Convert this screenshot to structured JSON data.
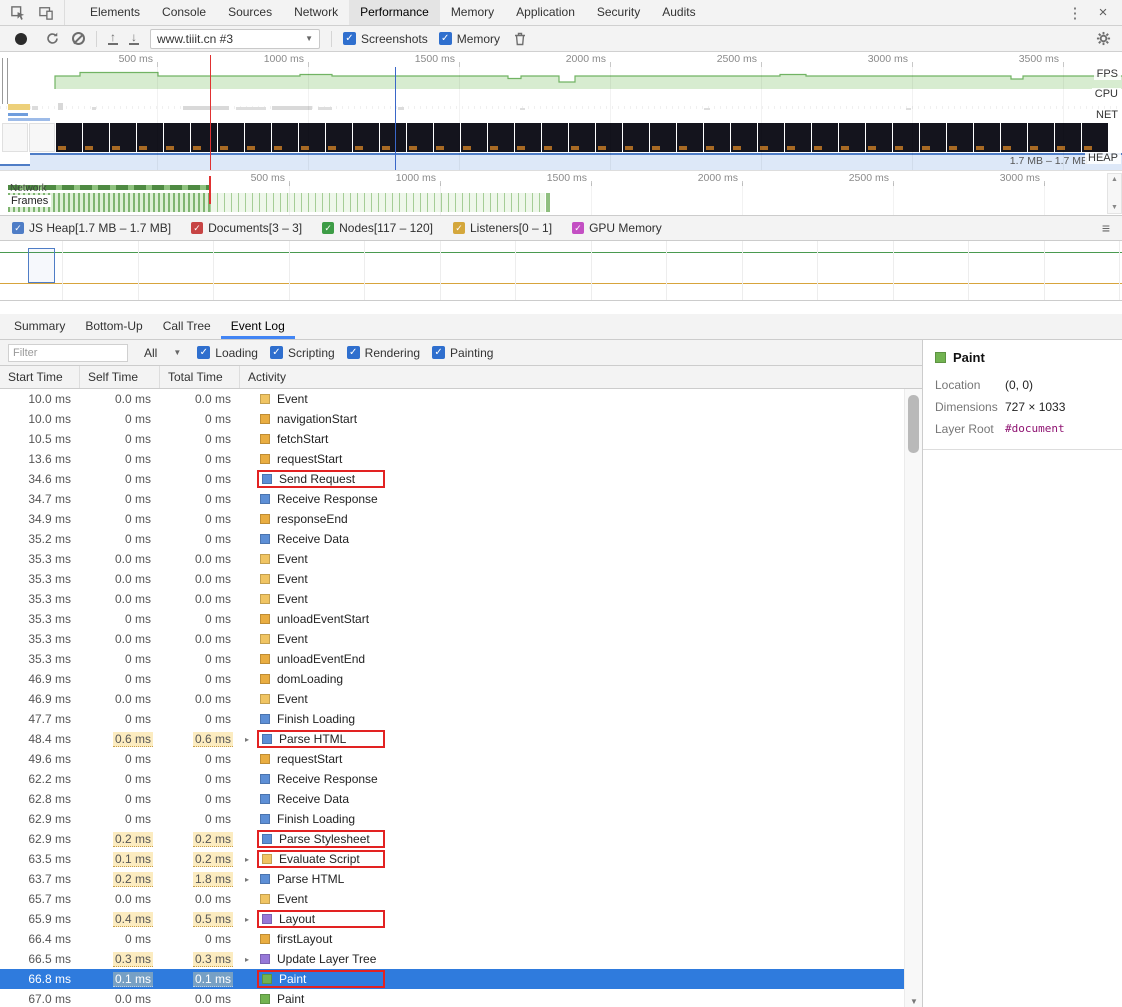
{
  "devtools": {
    "tabs": [
      "Elements",
      "Console",
      "Sources",
      "Network",
      "Performance",
      "Memory",
      "Application",
      "Security",
      "Audits"
    ],
    "active_tab": "Performance"
  },
  "toolbar": {
    "url_select": "www.tiiit.cn #3",
    "screenshots_label": "Screenshots",
    "memory_label": "Memory"
  },
  "overview": {
    "ruler_labels": [
      "500 ms",
      "1000 ms",
      "1500 ms",
      "2000 ms",
      "2500 ms",
      "3000 ms",
      "3500 ms"
    ],
    "track_labels": {
      "fps": "FPS",
      "cpu": "CPU",
      "net": "NET",
      "heap": "HEAP"
    },
    "heap_range": "1.7 MB – 1.7 MB",
    "filmstrip_count": 41,
    "filmstrip_light_count": 2
  },
  "timeline": {
    "network_label": "Network",
    "frames_label": "Frames"
  },
  "counters": {
    "items": [
      {
        "label": "JS Heap[1.7 MB – 1.7 MB]",
        "color": "#4f7dc6",
        "checked": true
      },
      {
        "label": "Documents[3 – 3]",
        "color": "#c74444",
        "checked": true
      },
      {
        "label": "Nodes[117 – 120]",
        "color": "#3d9c46",
        "checked": true
      },
      {
        "label": "Listeners[0 – 1]",
        "color": "#d4a73c",
        "checked": true
      },
      {
        "label": "GPU Memory",
        "color": "#c34fc3",
        "checked": true
      }
    ]
  },
  "detail_tabs": {
    "items": [
      "Summary",
      "Bottom-Up",
      "Call Tree",
      "Event Log"
    ],
    "active": "Event Log"
  },
  "filter_bar": {
    "filter_placeholder": "Filter",
    "duration": "All",
    "checkboxes": [
      "Loading",
      "Scripting",
      "Rendering",
      "Painting"
    ]
  },
  "event_log": {
    "columns": [
      "Start Time",
      "Self Time",
      "Total Time",
      "Activity"
    ],
    "rows": [
      {
        "start": "10.0 ms",
        "self": "0.0 ms",
        "total": "0.0 ms",
        "activity": "Event",
        "cat": "scripting"
      },
      {
        "start": "10.0 ms",
        "self": "0 ms",
        "total": "0 ms",
        "activity": "navigationStart",
        "cat": "timestamp"
      },
      {
        "start": "10.5 ms",
        "self": "0 ms",
        "total": "0 ms",
        "activity": "fetchStart",
        "cat": "timestamp"
      },
      {
        "start": "13.6 ms",
        "self": "0 ms",
        "total": "0 ms",
        "activity": "requestStart",
        "cat": "timestamp"
      },
      {
        "start": "34.6 ms",
        "self": "0 ms",
        "total": "0 ms",
        "activity": "Send Request",
        "cat": "loading",
        "redbox": true
      },
      {
        "start": "34.7 ms",
        "self": "0 ms",
        "total": "0 ms",
        "activity": "Receive Response",
        "cat": "loading"
      },
      {
        "start": "34.9 ms",
        "self": "0 ms",
        "total": "0 ms",
        "activity": "responseEnd",
        "cat": "timestamp"
      },
      {
        "start": "35.2 ms",
        "self": "0 ms",
        "total": "0 ms",
        "activity": "Receive Data",
        "cat": "loading"
      },
      {
        "start": "35.3 ms",
        "self": "0.0 ms",
        "total": "0.0 ms",
        "activity": "Event",
        "cat": "scripting"
      },
      {
        "start": "35.3 ms",
        "self": "0.0 ms",
        "total": "0.0 ms",
        "activity": "Event",
        "cat": "scripting"
      },
      {
        "start": "35.3 ms",
        "self": "0.0 ms",
        "total": "0.0 ms",
        "activity": "Event",
        "cat": "scripting"
      },
      {
        "start": "35.3 ms",
        "self": "0 ms",
        "total": "0 ms",
        "activity": "unloadEventStart",
        "cat": "timestamp"
      },
      {
        "start": "35.3 ms",
        "self": "0.0 ms",
        "total": "0.0 ms",
        "activity": "Event",
        "cat": "scripting"
      },
      {
        "start": "35.3 ms",
        "self": "0 ms",
        "total": "0 ms",
        "activity": "unloadEventEnd",
        "cat": "timestamp"
      },
      {
        "start": "46.9 ms",
        "self": "0 ms",
        "total": "0 ms",
        "activity": "domLoading",
        "cat": "timestamp"
      },
      {
        "start": "46.9 ms",
        "self": "0.0 ms",
        "total": "0.0 ms",
        "activity": "Event",
        "cat": "scripting"
      },
      {
        "start": "47.7 ms",
        "self": "0 ms",
        "total": "0 ms",
        "activity": "Finish Loading",
        "cat": "loading"
      },
      {
        "start": "48.4 ms",
        "self": "0.6 ms",
        "total": "0.6 ms",
        "activity": "Parse HTML",
        "cat": "loading",
        "expand": true,
        "hlSelf": true,
        "hlTotal": true,
        "redbox": true
      },
      {
        "start": "49.6 ms",
        "self": "0 ms",
        "total": "0 ms",
        "activity": "requestStart",
        "cat": "timestamp"
      },
      {
        "start": "62.2 ms",
        "self": "0 ms",
        "total": "0 ms",
        "activity": "Receive Response",
        "cat": "loading"
      },
      {
        "start": "62.8 ms",
        "self": "0 ms",
        "total": "0 ms",
        "activity": "Receive Data",
        "cat": "loading"
      },
      {
        "start": "62.9 ms",
        "self": "0 ms",
        "total": "0 ms",
        "activity": "Finish Loading",
        "cat": "loading"
      },
      {
        "start": "62.9 ms",
        "self": "0.2 ms",
        "total": "0.2 ms",
        "activity": "Parse Stylesheet",
        "cat": "loading",
        "hlSelf": true,
        "hlTotal": true,
        "redbox": true
      },
      {
        "start": "63.5 ms",
        "self": "0.1 ms",
        "total": "0.2 ms",
        "activity": "Evaluate Script",
        "cat": "scripting",
        "expand": true,
        "hlSelf": true,
        "hlTotal": true,
        "redbox": true
      },
      {
        "start": "63.7 ms",
        "self": "0.2 ms",
        "total": "1.8 ms",
        "activity": "Parse HTML",
        "cat": "loading",
        "expand": true,
        "hlSelf": true,
        "hlTotal": true
      },
      {
        "start": "65.7 ms",
        "self": "0.0 ms",
        "total": "0.0 ms",
        "activity": "Event",
        "cat": "scripting"
      },
      {
        "start": "65.9 ms",
        "self": "0.4 ms",
        "total": "0.5 ms",
        "activity": "Layout",
        "cat": "rendering",
        "expand": true,
        "hlSelf": true,
        "hlTotal": true,
        "redbox": true
      },
      {
        "start": "66.4 ms",
        "self": "0 ms",
        "total": "0 ms",
        "activity": "firstLayout",
        "cat": "timestamp"
      },
      {
        "start": "66.5 ms",
        "self": "0.3 ms",
        "total": "0.3 ms",
        "activity": "Update Layer Tree",
        "cat": "rendering",
        "expand": true,
        "hlSelf": true,
        "hlTotal": true
      },
      {
        "start": "66.8 ms",
        "self": "0.1 ms",
        "total": "0.1 ms",
        "activity": "Paint",
        "cat": "painting",
        "selected": true,
        "hlSelf": true,
        "hlTotal": true,
        "redbox": true
      },
      {
        "start": "67.0 ms",
        "self": "0.0 ms",
        "total": "0.0 ms",
        "activity": "Paint",
        "cat": "painting"
      }
    ]
  },
  "details_pane": {
    "title": "Paint",
    "rows": [
      {
        "label": "Location",
        "value": "(0, 0)"
      },
      {
        "label": "Dimensions",
        "value": "727 × 1033"
      },
      {
        "label": "Layer Root",
        "value": "#document",
        "mono": true
      }
    ]
  },
  "colors": {
    "loading": "#5d8fd6",
    "scripting": "#f0c462",
    "rendering": "#9678d8",
    "painting": "#72b351",
    "timestamp": "#e9ad41",
    "selection": "#2f7bdd",
    "highlight": "#fcecc0",
    "accent": "#4285f4",
    "annotation": "#e22222"
  },
  "icons": {
    "kebab": "⋮",
    "close": "×",
    "dropdown": "▼",
    "check": "✓",
    "hamburger": "≡",
    "expander": "▸",
    "up_arrow": "↑",
    "down_arrow": "↓",
    "scroll_up": "▲",
    "scroll_down": "▼"
  }
}
